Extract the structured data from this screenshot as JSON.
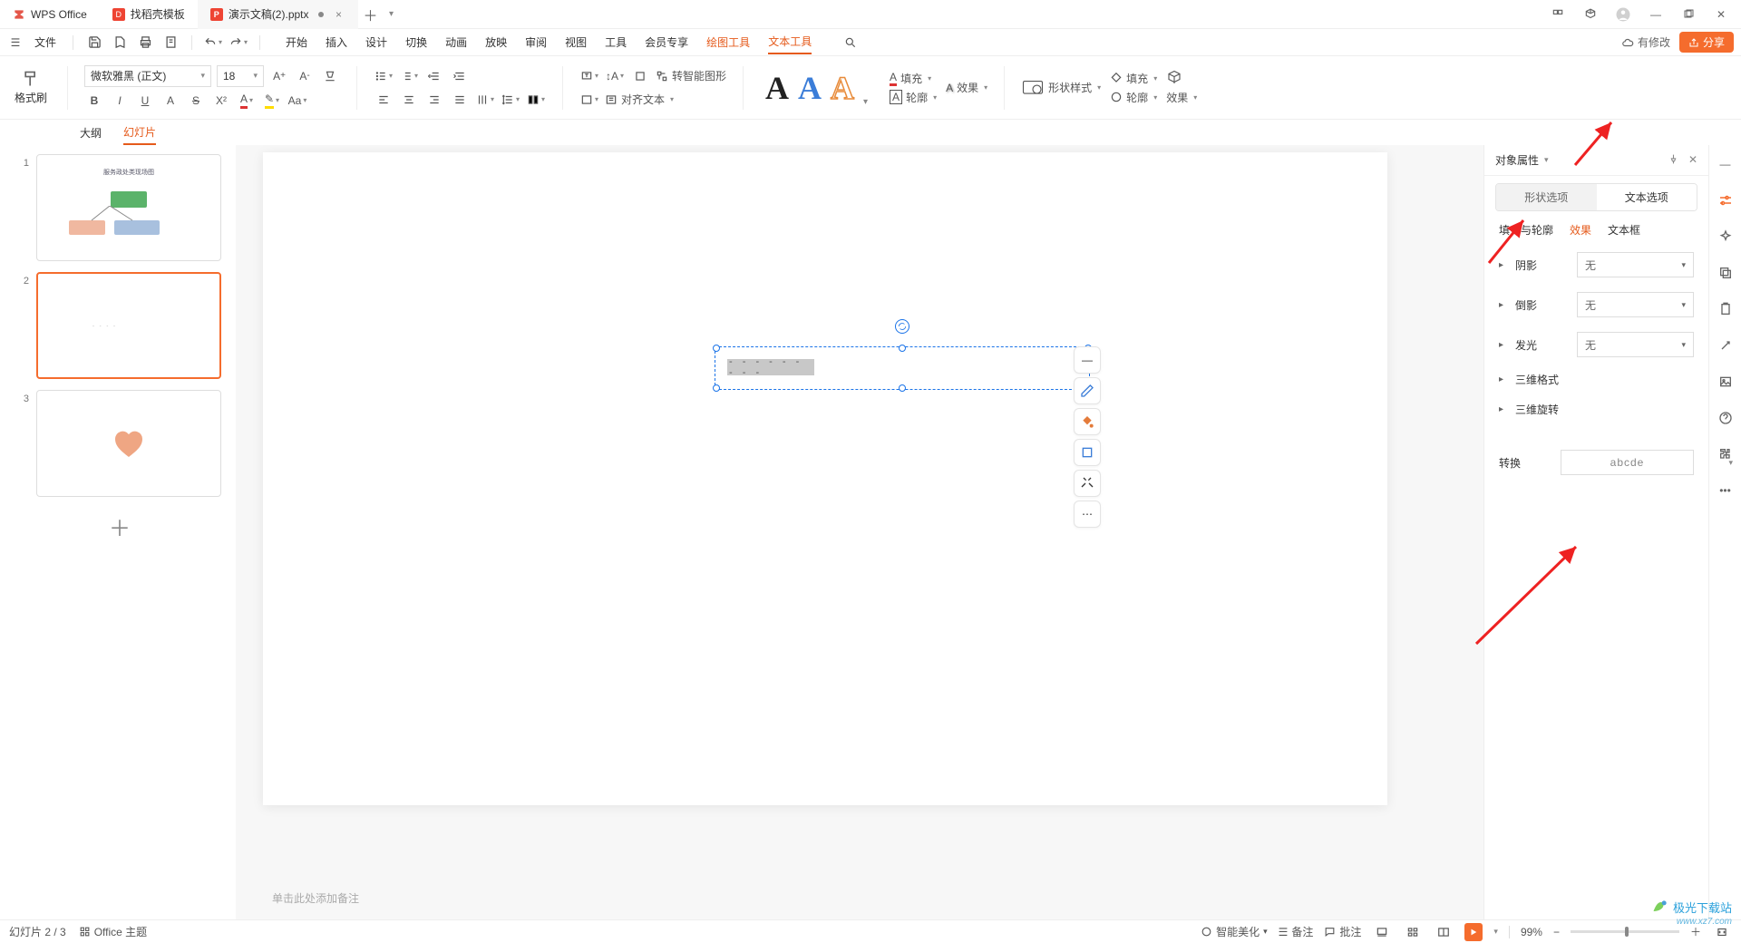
{
  "titlebar": {
    "tabs": [
      {
        "icon": "wps",
        "label": "WPS Office"
      },
      {
        "icon": "doc",
        "label": "找稻壳模板"
      },
      {
        "icon": "ppt",
        "label": "演示文稿(2).pptx",
        "dirty": true
      }
    ]
  },
  "menubar": {
    "file": "文件",
    "tabs": [
      "开始",
      "插入",
      "设计",
      "切换",
      "动画",
      "放映",
      "审阅",
      "视图",
      "工具",
      "会员专享",
      "绘图工具",
      "文本工具"
    ],
    "active_tabs": [
      "绘图工具",
      "文本工具"
    ],
    "revise": "有修改",
    "share": "分享"
  },
  "ribbon": {
    "format_painter": "格式刷",
    "font": "微软雅黑 (正文)",
    "size": "18",
    "convert_shape": "转智能图形",
    "align_text": "对齐文本",
    "styleA": {
      "a1": "A",
      "a2": "A",
      "a3": "A"
    },
    "fill": "填充",
    "outline": "轮廓",
    "effects": "效果",
    "shape_style": "形状样式",
    "shape_fill": "填充",
    "shape_outline": "轮廓",
    "shape_effects": "效果"
  },
  "sidepanel": {
    "outline": "大纲",
    "slides": "幻灯片",
    "count": 3
  },
  "slides_thumbs": [
    "1",
    "2",
    "3"
  ],
  "notes_placeholder": "单击此处添加备注",
  "right_panel": {
    "title": "对象属性",
    "tab_shape": "形状选项",
    "tab_text": "文本选项",
    "sub_fill": "填充与轮廓",
    "sub_effect": "效果",
    "sub_textbox": "文本框",
    "sec_shadow": "阴影",
    "sec_reflect": "倒影",
    "sec_glow": "发光",
    "sec_3dformat": "三维格式",
    "sec_3drotate": "三维旋转",
    "sec_transform": "转换",
    "none": "无",
    "sample": "abcde"
  },
  "statusbar": {
    "slide_counter": "幻灯片 2 / 3",
    "theme": "Office 主题",
    "beautify": "智能美化",
    "notes": "备注",
    "comments": "批注",
    "zoom": "99%"
  },
  "watermark": {
    "brand": "极光下载站",
    "url": "www.xz7.com"
  }
}
